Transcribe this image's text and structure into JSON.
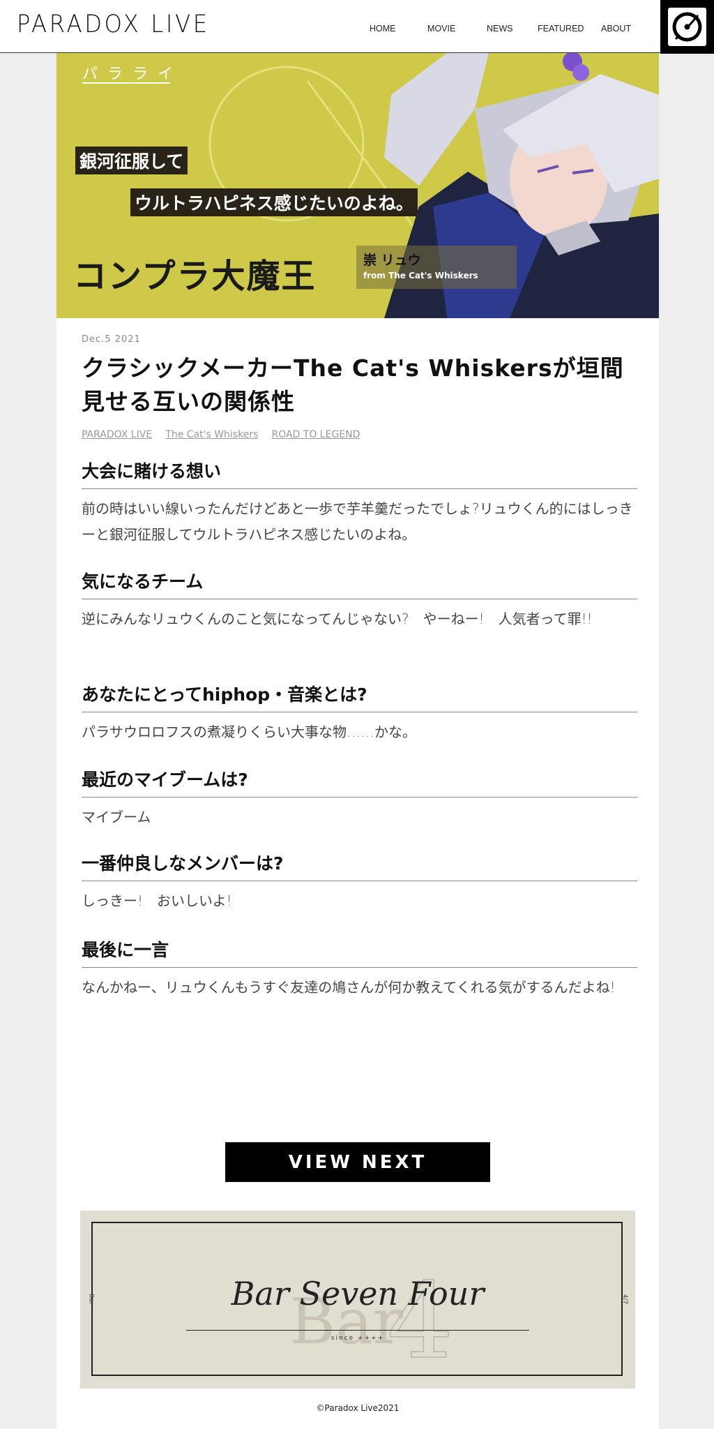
{
  "header": {
    "logo": "PARADOX LIVE",
    "nav": [
      "HOME",
      "MOVIE",
      "NEWS",
      "FEATURED",
      "ABOUT"
    ]
  },
  "hero": {
    "kana": "パラライ",
    "quote_line1": "銀河征服して",
    "quote_line2": "ウルトラハピネス感じたいのよね。",
    "name": "コンプラ大魔王",
    "character": "崇 リュウ",
    "team": "from The Cat's Whiskers",
    "bg_color": "#cfc94a"
  },
  "article": {
    "date": "Dec.5 2021",
    "title": "クラシックメーカーThe Cat's Whiskersが垣間見せる互いの関係性",
    "tags": [
      "PARADOX LIVE",
      "The Cat's Whiskers",
      "ROAD TO LEGEND"
    ],
    "qa": [
      {
        "q": "大会に賭ける想い",
        "a": "前の時はいい線いったんだけどあと一歩で芋羊羹だったでしょ?リュウくん的にはしっきーと銀河征服してウルトラハピネス感じたいのよね。"
      },
      {
        "q": "気になるチーム",
        "a": "逆にみんなリュウくんのこと気になってんじゃない?　やーねー!　人気者って罪!!"
      },
      {
        "q": "あなたにとってhiphop・音楽とは?",
        "a": "パラサウロロフスの煮凝りくらい大事な物……かな。"
      },
      {
        "q": "最近のマイブームは?",
        "a": "マイブーム"
      },
      {
        "q": "一番仲良しなメンバーは?",
        "a": "しっきー!　おいしいよ!"
      },
      {
        "q": "最後に一言",
        "a": "なんかねー、リュウくんもうすぐ友達の鳩さんが何か教えてくれる気がするんだよね!"
      }
    ]
  },
  "view_next": "VIEW NEXT",
  "banner": {
    "title": "Bar Seven Four",
    "since": "since ++++",
    "side_left": "Bar",
    "side_right": "4/7"
  },
  "footer": {
    "copyright": "©Paradox Live2021"
  }
}
